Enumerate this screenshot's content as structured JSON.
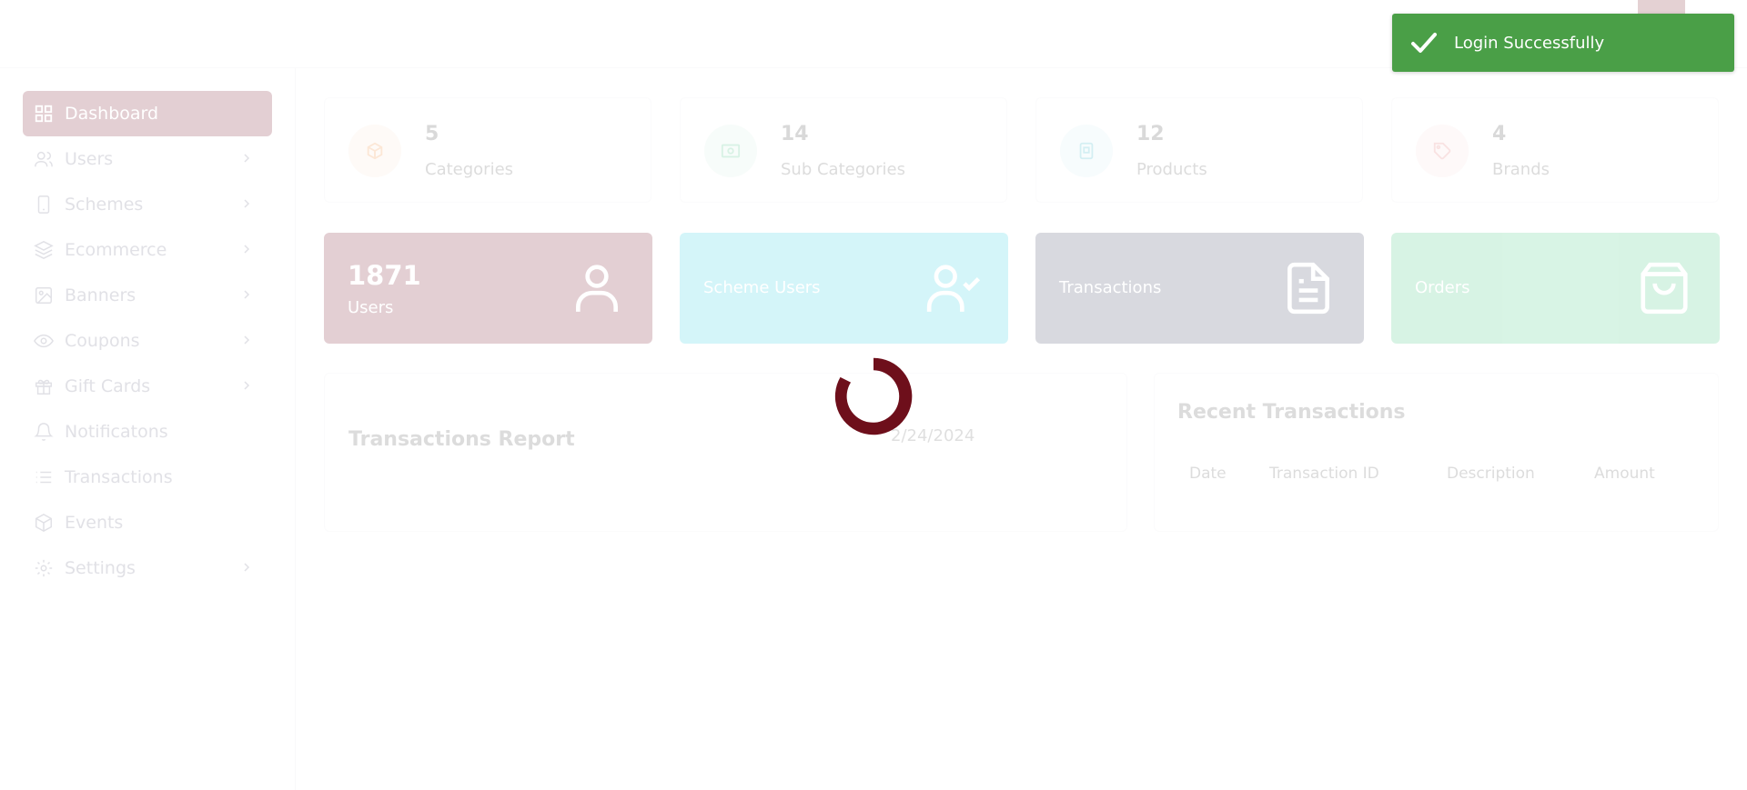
{
  "sidebar": {
    "items": [
      {
        "label": "Dashboard",
        "icon": "dashboard-icon",
        "active": true,
        "has_chevron": false
      },
      {
        "label": "Users",
        "icon": "users-icon",
        "has_chevron": true
      },
      {
        "label": "Schemes",
        "icon": "phone-icon",
        "has_chevron": true
      },
      {
        "label": "Ecommerce",
        "icon": "layers-icon",
        "has_chevron": true
      },
      {
        "label": "Banners",
        "icon": "image-icon",
        "has_chevron": true
      },
      {
        "label": "Coupons",
        "icon": "eye-icon",
        "has_chevron": true
      },
      {
        "label": "Gift Cards",
        "icon": "gift-icon",
        "has_chevron": true
      },
      {
        "label": "Notificatons",
        "icon": "bell-icon",
        "has_chevron": false
      },
      {
        "label": "Transactions",
        "icon": "list-icon",
        "has_chevron": false
      },
      {
        "label": "Events",
        "icon": "box-icon",
        "has_chevron": false
      },
      {
        "label": "Settings",
        "icon": "gear-icon",
        "has_chevron": true
      }
    ]
  },
  "stats": [
    {
      "value": "5",
      "label": "Categories",
      "icon": "category-icon",
      "color": "#f28c38"
    },
    {
      "value": "14",
      "label": "Sub Categories",
      "icon": "banknote-icon",
      "color": "#3fbf7f"
    },
    {
      "value": "12",
      "label": "Products",
      "icon": "product-icon",
      "color": "#2fb3c8"
    },
    {
      "value": "4",
      "label": "Brands",
      "icon": "tag-icon",
      "color": "#e37373"
    }
  ],
  "cards": [
    {
      "value": "1871",
      "label": "Users",
      "icon": "user-icon",
      "color": "#7a1728"
    },
    {
      "value": "",
      "label": "Scheme Users",
      "icon": "user-check-icon",
      "color": "#2ed0e3"
    },
    {
      "value": "",
      "label": "Transactions",
      "icon": "document-icon",
      "color": "#3f4864"
    },
    {
      "value": "",
      "label": "Orders",
      "icon": "shopping-bag-icon",
      "color": "#3ec77c"
    }
  ],
  "report": {
    "title": "Transactions Report",
    "date": "2/24/2024"
  },
  "recent": {
    "title": "Recent Transactions",
    "columns": [
      "Date",
      "Transaction ID",
      "Description",
      "Amount"
    ]
  },
  "toast": {
    "message": "Login Successfully",
    "color": "#4a9f47"
  },
  "colors": {
    "accent": "#7a1728",
    "spinner": "#6e0f1b"
  }
}
